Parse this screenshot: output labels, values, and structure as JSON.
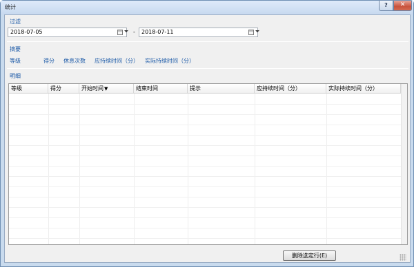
{
  "window": {
    "title": "统计",
    "help_glyph": "?",
    "close_glyph": "✕"
  },
  "filter": {
    "label": "过滤",
    "start_date": "2018-07-05",
    "separator": "-",
    "end_date": "2018-07-11"
  },
  "summary": {
    "label": "摘要",
    "items": [
      "等级",
      "得分",
      "休息次数",
      "应持续时间（分）",
      "实际持续时间（分）"
    ]
  },
  "detail": {
    "label": "明细",
    "columns": [
      "等级",
      "得分",
      "开始时间",
      "结束时间",
      "提示",
      "应持续时间（分）",
      "实际持续时间（分）"
    ],
    "sort_indicator": "▼",
    "rows": []
  },
  "actions": {
    "delete_selected_label": "删除选定行(E)"
  }
}
